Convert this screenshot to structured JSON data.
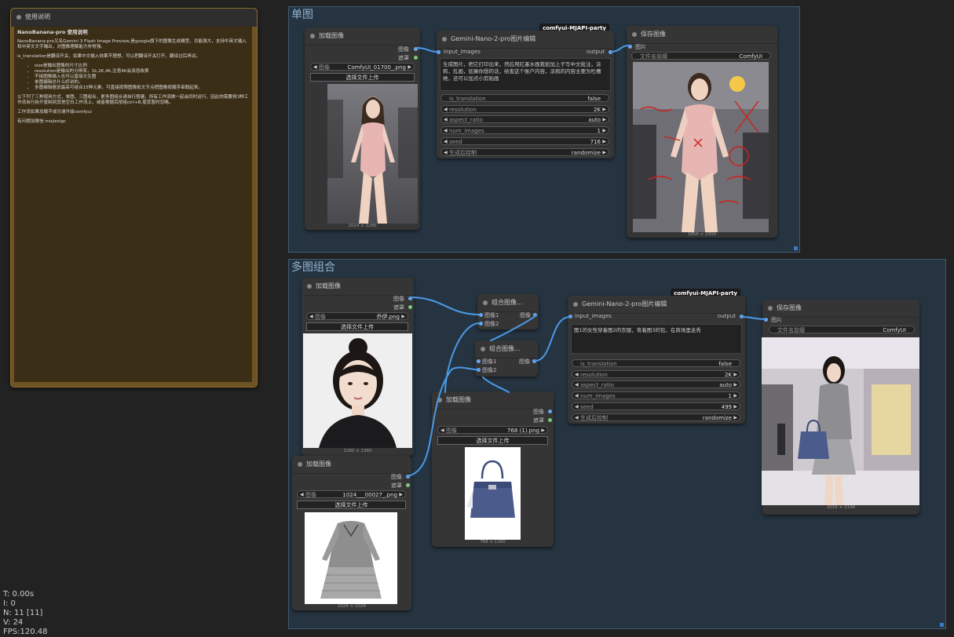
{
  "note": {
    "title": "使用说明",
    "heading": "NanoBanana-pro 使用说明",
    "intro": "NanoBanana-pro又名Gemini 3 Flash Image Preview,是google旗下的图像生成模型，功能强大，支持中英文输入和中英文文字输出，对图像理解能力非常强。",
    "translation": "is_translation是翻译开关，如果中文输入效果不理想，可以把翻译开关打开，翻译过后再试。",
    "bullets": [
      "size是输出图像的尺寸比例",
      "resolution是输出的分辨率，1k,2K,4K,注意4K会双倍收费",
      "不接图像输入也可以直接文生图",
      "单图编辑总什么好讲的。",
      "多图编辑据说最高可组合15种元素，可直接按照图像批文节点把图像按顺序串联起来。"
    ],
    "para2": "以下列了三种使用方式，单图、三图组合，更多图组合请自行搭建。所有工作流做一起会同时运行，因此你需要将3种工作流自行拆开复制到其他空白工作流上，或者根据后按组ctrl+B,使其暂时忽略。",
    "para3": "工作流如果加载不成功请升级comfyui",
    "para4": "有问题加微信:mojiesigc"
  },
  "stats": {
    "t": "T: 0.00s",
    "i": "I: 0",
    "n": "N: 11 [11]",
    "v": "V: 24",
    "fps": "FPS:120.48"
  },
  "groups": {
    "single": "单图",
    "multi": "多图组合"
  },
  "labels": {
    "load_image": "加载图像",
    "gemini_node": "Gemini-Nano-2-pro图片编辑",
    "save_image": "保存图像",
    "combine": "组合图像...",
    "badge": "comfyui-MJAPI-party",
    "out_image": "图像",
    "out_mask": "遮罩",
    "input_images": "input_images",
    "output": "output",
    "in_image": "图片",
    "in_image1": "图像1",
    "in_image2": "图像2",
    "image_widget": "图像",
    "upload": "选择文件上传",
    "filename_prefix": "文件名前缀",
    "filename_value": "ComfyUI",
    "is_translation": "is_translation",
    "resolution": "resolution",
    "aspect_ratio": "aspect_ratio",
    "num_images": "num_images",
    "seed": "seed",
    "after_gen": "生成后控制"
  },
  "single": {
    "load_file": "ComfyUI_01700_.png",
    "load_dim": "1024 × 1280",
    "prompt": "生成图片，把它打印出来，然后用红墨水画我如加上子写中文批注，涂鸦，乱画，如果你想的话，给害这个账户内容，涂鸦的内容主要为吐槽她，还可以加点小剪贴画",
    "is_translation": "false",
    "resolution": "2K",
    "aspect_ratio": "auto",
    "num_images": "1",
    "seed": "716",
    "after_gen": "randomize",
    "save_dim": "1656 × 2304"
  },
  "multi": {
    "load1_file": "乔伊.png",
    "load1_dim": "1280 × 1360",
    "load2_file": "1024___00027_.png",
    "load2_dim": "1024 × 1024",
    "load3_file": "768 (1).png",
    "load3_dim": "768 × 1280",
    "prompt": "图1的女性穿着图2的衣服，背着图3的包，在商场里走秀",
    "is_translation": "false",
    "resolution": "2K",
    "aspect_ratio": "auto",
    "num_images": "1",
    "seed": "499",
    "after_gen": "randomize",
    "save_dim": "2016 × 2144"
  },
  "colors": {
    "canvas": "#222222",
    "group_bg": "#263441",
    "note_border": "#7a5a27",
    "link": "#4a9ae8"
  }
}
